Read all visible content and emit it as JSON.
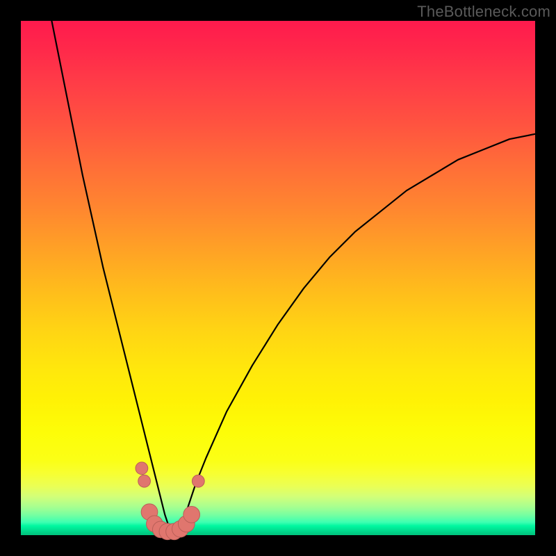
{
  "watermark": "TheBottleneck.com",
  "colors": {
    "frame": "#000000",
    "curve_stroke": "#000000",
    "marker_fill": "#e0766e",
    "marker_stroke": "#b95f58"
  },
  "chart_data": {
    "type": "line",
    "title": "",
    "xlabel": "",
    "ylabel": "",
    "xlim": [
      0,
      100
    ],
    "ylim": [
      0,
      100
    ],
    "grid": false,
    "legend": false,
    "notes": "V-shaped bottleneck curve over rainbow heatmap background. Minimum near x≈29. No axis ticks/labels shown. y values approximate (read as % of plot height).",
    "series": [
      {
        "name": "curve",
        "x": [
          6,
          8,
          10,
          12,
          14,
          16,
          18,
          20,
          22,
          23,
          24,
          25,
          26,
          27,
          28,
          29,
          30,
          31,
          32,
          33,
          34,
          36,
          40,
          45,
          50,
          55,
          60,
          65,
          70,
          75,
          80,
          85,
          90,
          95,
          100
        ],
        "y": [
          100,
          90,
          80,
          70,
          61,
          52,
          44,
          36,
          28,
          24,
          20,
          16,
          12,
          8,
          4,
          1,
          1,
          2,
          4,
          7,
          10,
          15,
          24,
          33,
          41,
          48,
          54,
          59,
          63,
          67,
          70,
          73,
          75,
          77,
          78
        ]
      }
    ],
    "markers": [
      {
        "x": 23.5,
        "y": 13,
        "r": 1.2
      },
      {
        "x": 24.0,
        "y": 10.5,
        "r": 1.2
      },
      {
        "x": 25.0,
        "y": 4.5,
        "r": 1.6
      },
      {
        "x": 26.0,
        "y": 2.2,
        "r": 1.6
      },
      {
        "x": 27.2,
        "y": 1.1,
        "r": 1.6
      },
      {
        "x": 28.5,
        "y": 0.7,
        "r": 1.6
      },
      {
        "x": 29.8,
        "y": 0.7,
        "r": 1.6
      },
      {
        "x": 31.0,
        "y": 1.2,
        "r": 1.6
      },
      {
        "x": 32.2,
        "y": 2.2,
        "r": 1.6
      },
      {
        "x": 33.2,
        "y": 4.0,
        "r": 1.6
      },
      {
        "x": 34.5,
        "y": 10.5,
        "r": 1.2
      }
    ]
  }
}
